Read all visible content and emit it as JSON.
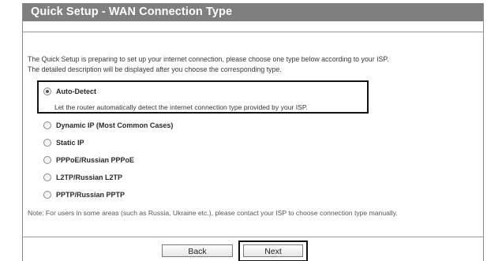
{
  "header": {
    "title": "Quick Setup - WAN Connection Type"
  },
  "description": {
    "line1": "The Quick Setup is preparing to set up your internet connection, please choose one type below according to your ISP.",
    "line2": "The detailed description will be displayed after you choose the corresponding type."
  },
  "options": [
    {
      "label": "Auto-Detect",
      "selected": true
    },
    {
      "label": "Dynamic IP (Most Common Cases)",
      "selected": false
    },
    {
      "label": "Static IP",
      "selected": false
    },
    {
      "label": "PPPoE/Russian PPPoE",
      "selected": false
    },
    {
      "label": "L2TP/Russian L2TP",
      "selected": false
    },
    {
      "label": "PPTP/Russian PPTP",
      "selected": false
    }
  ],
  "autodetect_description": "Let the router automatically detect the internet connection type provided by your ISP.",
  "note": "Note: For users in some areas (such as Russia, Ukraine etc.), please contact your ISP to choose connection type manually.",
  "buttons": {
    "back": "Back",
    "next": "Next"
  },
  "colors": {
    "title_bar": "#7f7f7f",
    "highlight_border": "#111111"
  }
}
